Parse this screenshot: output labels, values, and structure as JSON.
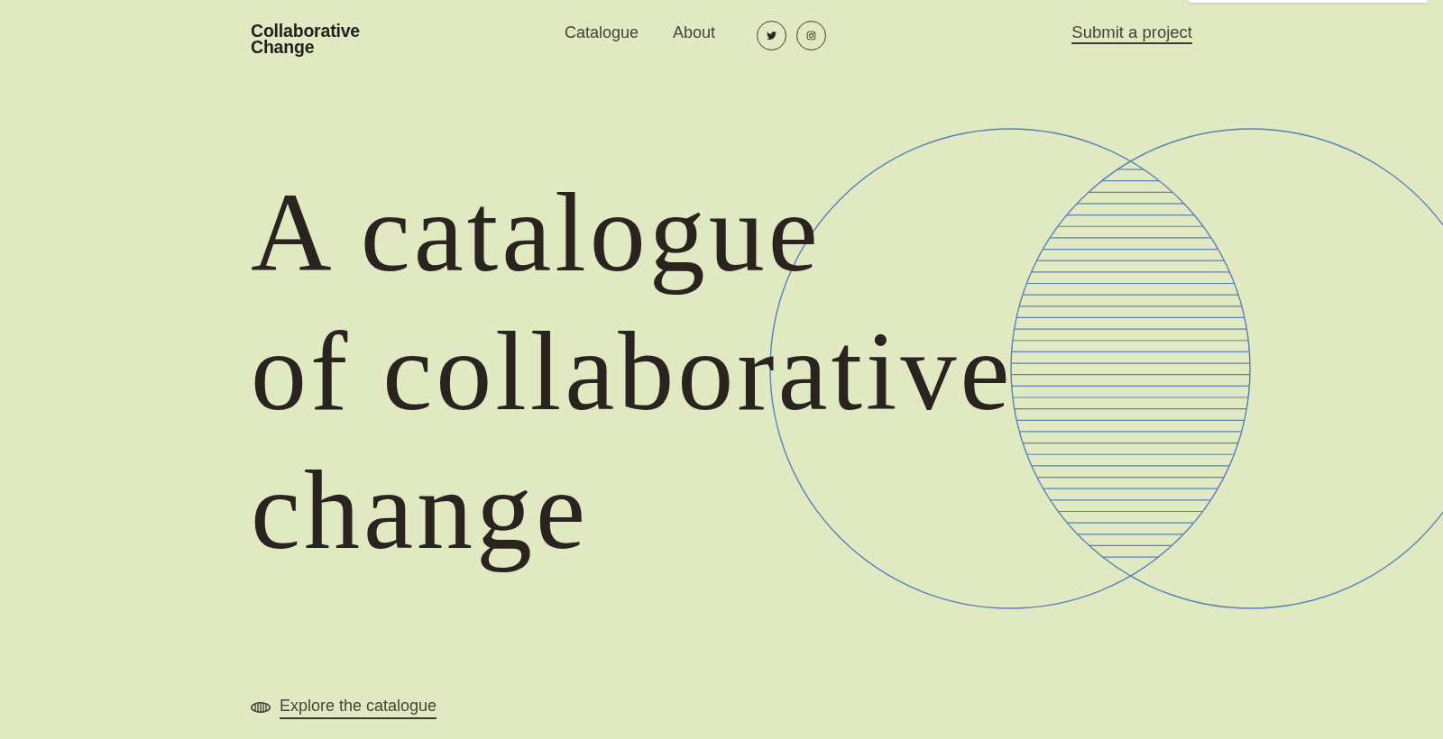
{
  "header": {
    "logo": [
      "Collaborative",
      "Change"
    ],
    "nav": [
      {
        "label": "Catalogue"
      },
      {
        "label": "About"
      }
    ],
    "cta": "Submit a project"
  },
  "hero": {
    "title_lines": [
      "A catalogue",
      "of collaborative",
      "change"
    ],
    "link": "Explore the catalogue"
  }
}
